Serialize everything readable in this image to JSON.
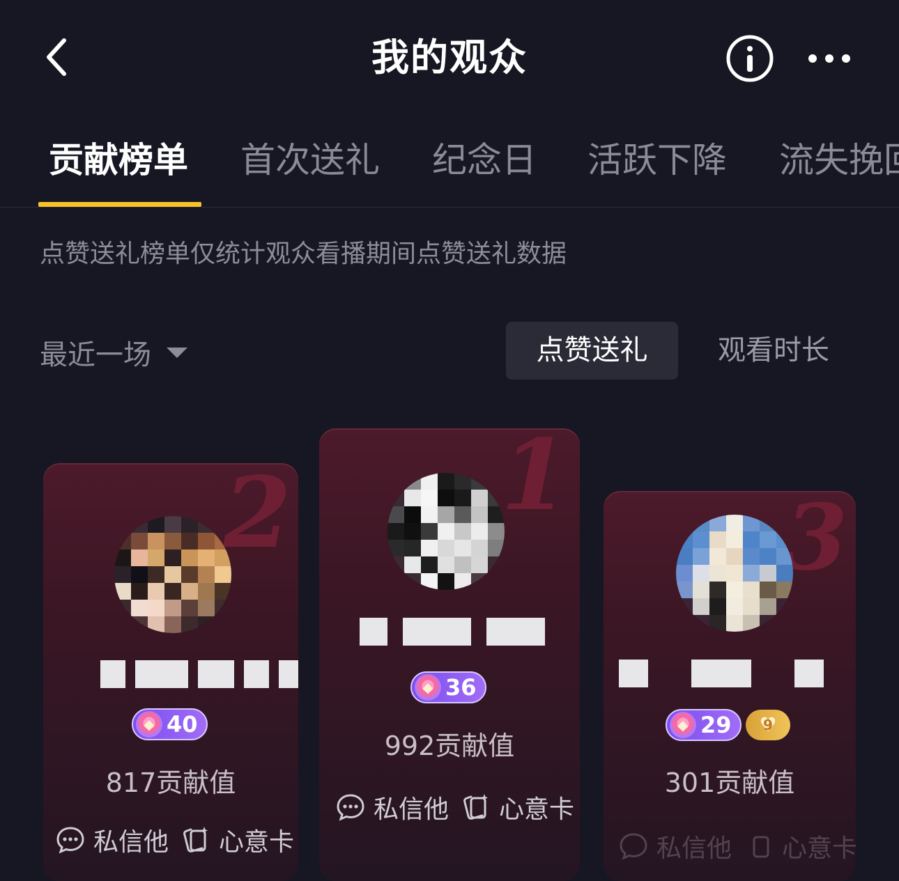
{
  "header": {
    "title": "我的观众",
    "back_icon": "chevron-left-icon",
    "info_icon": "info-circle-icon",
    "more_icon": "more-horizontal-icon"
  },
  "tabs": [
    {
      "label": "贡献榜单",
      "active": true
    },
    {
      "label": "首次送礼",
      "active": false
    },
    {
      "label": "纪念日",
      "active": false
    },
    {
      "label": "活跃下降",
      "active": false
    },
    {
      "label": "流失挽回",
      "active": false
    }
  ],
  "notice": "点赞送礼榜单仅统计观众看播期间点赞送礼数据",
  "filter": {
    "range_selected": "最近一场",
    "segments": [
      "点赞送礼",
      "观看时长"
    ],
    "segment_selected": "点赞送礼"
  },
  "podium": [
    {
      "rank": "2",
      "level": "40",
      "contribution": "817贡献值",
      "fan_badge": "",
      "actions": [
        "私信他",
        "心意卡"
      ]
    },
    {
      "rank": "1",
      "level": "36",
      "contribution": "992贡献值",
      "fan_badge": "",
      "actions": [
        "私信他",
        "心意卡"
      ]
    },
    {
      "rank": "3",
      "level": "29",
      "contribution": "301贡献值",
      "fan_badge": "9",
      "actions": [
        "私信他",
        "心意卡"
      ]
    }
  ],
  "colors": {
    "background": "#161722",
    "tab_indicator": "#f8c22a",
    "card_top": "#4c1a2b",
    "level_badge": "#8b5cf6",
    "fan_badge": "#e0ad44"
  }
}
